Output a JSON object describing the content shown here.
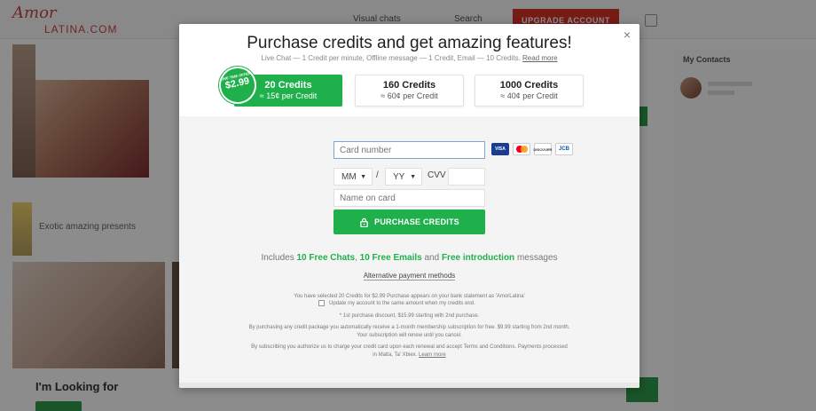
{
  "background": {
    "logo_top": "Amor",
    "logo_bottom": "LATINA.COM",
    "nav_items": [
      "Visual chats",
      "Search"
    ],
    "upgrade_label": "UPGRADE ACCOUNT",
    "photo_caption": "Exotic amazing presents",
    "looking_for": "I'm Looking for",
    "right_title": "My Contacts"
  },
  "modal": {
    "close_glyph": "×",
    "title": "Purchase credits and get amazing features!",
    "subtitle": "Live Chat — 1 Credit per minute, Offline message — 1 Credit, Email — 10 Credits.",
    "read_more": "Read more",
    "offer_badge": {
      "top": "ONE TIME OFFER",
      "price": "$2.99"
    },
    "plans": [
      {
        "title": "20 Credits",
        "price": "≈ 15¢ per Credit",
        "selected": true
      },
      {
        "title": "160 Credits",
        "price": "≈ 60¢ per Credit",
        "selected": false
      },
      {
        "title": "1000 Credits",
        "price": "≈ 40¢ per Credit",
        "selected": false
      }
    ],
    "form": {
      "card_number_placeholder": "Card number",
      "card_icons": [
        "VISA",
        "",
        "DISCOVER",
        "JCB"
      ],
      "month": "MM",
      "year": "YY",
      "slash": "/",
      "cvv_label": "CVV",
      "name_placeholder": "Name on card",
      "purchase_label": "PURCHASE CREDITS"
    },
    "includes": {
      "prefix": "Includes",
      "chats": "10 Free Chats",
      "comma": ",",
      "emails": "10 Free Emails",
      "and": "and",
      "intro": "Free introduction",
      "suffix": "messages"
    },
    "alternative_payment": "Alternative payment methods",
    "fine_print": {
      "selected_line": "You have selected 20 Credits for $2.99 Purchase appears on your bank statement as 'AmorLatina'",
      "update_checkbox": "Update my account to the same amount when my credits end.",
      "discount_line": "* 1st purchase discount, $15.99 starting with 2nd purchase.",
      "membership_line1": "By purchasing any credit package you automatically receive a 1-month membership subscription for free. $9.99 starting from 2nd month.",
      "membership_line2": "Your subscription will renew until you cancel.",
      "authorize_line1": "By subscribing you authorize us to charge your credit card upon each renewal and accept Terms and Conditions. Payments processed",
      "authorize_line2": "in Malta, Ta' Xbiex.",
      "learn_more": "Learn more"
    }
  }
}
